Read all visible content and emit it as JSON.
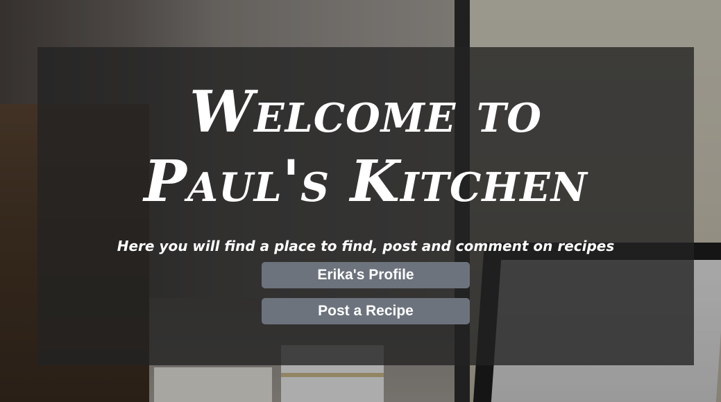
{
  "hero": {
    "title": "Welcome to Paul's Kitchen",
    "tagline": "Here you will find a place to find, post and comment on recipes"
  },
  "actions": {
    "profile_label": "Erika's Profile",
    "post_label": "Post a Recipe"
  },
  "colors": {
    "panel_overlay": "#222222",
    "button_bg": "#6c737c",
    "text": "#ffffff"
  }
}
